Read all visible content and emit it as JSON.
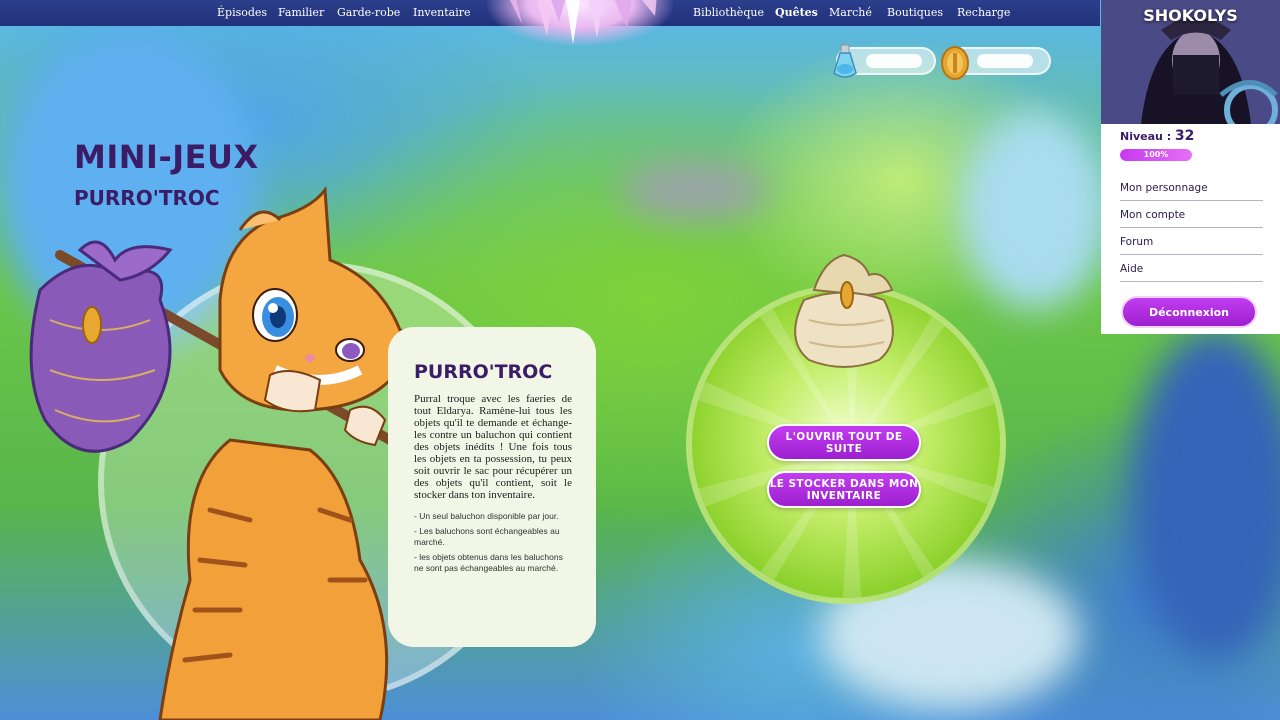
{
  "nav": {
    "left": [
      "Épisodes",
      "Familier",
      "Garde-robe",
      "Inventaire"
    ],
    "right": [
      "Bibliothèque",
      "Quêtes",
      "Marché",
      "Boutiques",
      "Recharge"
    ],
    "active": "Quêtes"
  },
  "currency": {
    "potion_value": "",
    "gold_value": ""
  },
  "page": {
    "title": "MINI-JEUX",
    "subtitle": "PURRO'TROC"
  },
  "card": {
    "title": "PURRO'TROC",
    "description": "Purral troque avec les faeries de tout Eldarya. Ramène-lui tous les objets qu'il te demande et échange-les contre un baluchon qui contient des objets inédits ! Une fois tous les objets en ta possession, tu peux soit ouvrir le sac pour récupérer un des objets qu'il contient, soit le stocker dans ton inventaire.",
    "notes": [
      "- Un seul baluchon disponible par jour.",
      "- Les baluchons sont échangeables au marché.",
      "- les objets obtenus dans les baluchons ne sont pas échangeables au marché."
    ]
  },
  "actions": {
    "open_now": "L'OUVRIR TOUT DE SUITE",
    "store": "LE STOCKER DANS MON INVENTAIRE"
  },
  "profile": {
    "username": "SHOKOLYS",
    "level_label": "Niveau : ",
    "level": "32",
    "xp_percent_text": "100%",
    "xp_fraction": 1.0,
    "links": [
      "Mon personnage",
      "Mon compte",
      "Forum",
      "Aide"
    ],
    "logout": "Déconnexion"
  },
  "colors": {
    "nav_bg": "#22317a",
    "title_purple": "#3a1c67",
    "button_magenta": "#b12de0"
  }
}
